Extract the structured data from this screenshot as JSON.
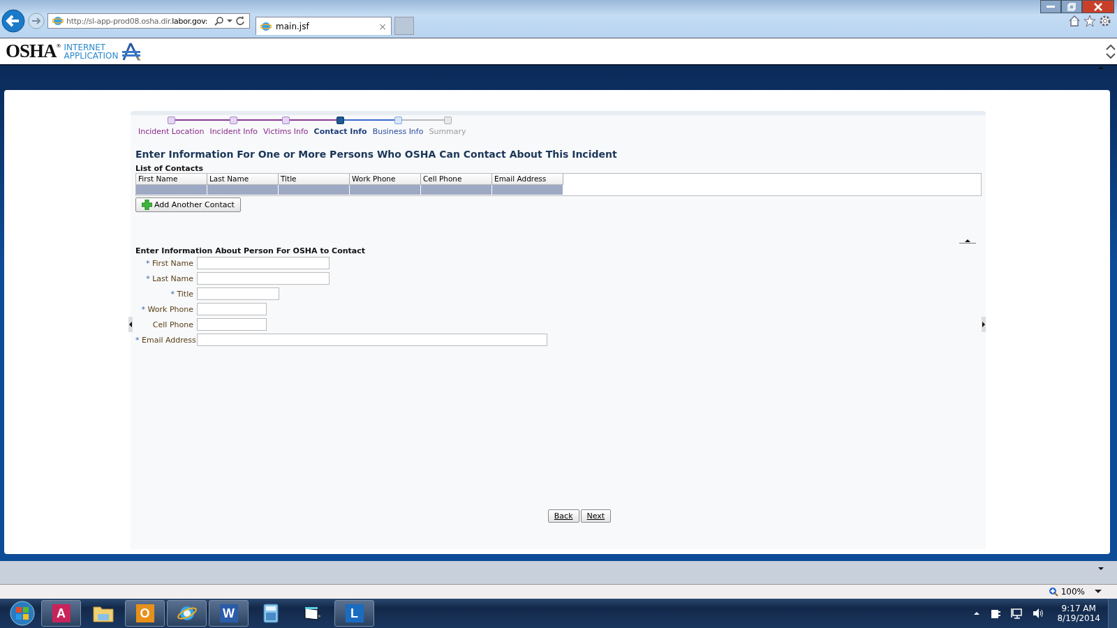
{
  "browser": {
    "url": "http://sl-app-prod08.osha.dir.**labor.gov:**",
    "tab": {
      "title": "main.jsf",
      "close": "×"
    }
  },
  "logo": {
    "mark": "OSHA",
    "registered": "®",
    "line_1": "INTERNET",
    "line_2": "APPLICATION"
  },
  "steps": [
    {
      "label": "Incident Location",
      "kind": "completed"
    },
    {
      "label": "Incident Info",
      "kind": "completed"
    },
    {
      "label": "Victims Info",
      "kind": "completed"
    },
    {
      "label": "Contact Info",
      "kind": "current"
    },
    {
      "label": "Business Info",
      "kind": "next"
    },
    {
      "label": "Summary",
      "kind": "pending"
    }
  ],
  "heading": "Enter Information For One or More Persons Who OSHA Can Contact About This Incident",
  "table": {
    "title": "List of Contacts",
    "columns": [
      "First Name",
      "Last Name",
      "Title",
      "Work Phone",
      "Cell Phone",
      "Email Address"
    ],
    "rows": [
      {
        "selected": true
      }
    ]
  },
  "add_button": "Add Another Contact",
  "form": {
    "title": "Enter Information About Person For OSHA to Contact",
    "fields": [
      {
        "mark": "*",
        "label": "First Name",
        "kind": "long"
      },
      {
        "mark": "*",
        "label": "Last Name",
        "kind": "long"
      },
      {
        "mark": "*",
        "label": "Title",
        "kind": "medium"
      },
      {
        "mark": "*",
        "label": "Work Phone",
        "kind": "short"
      },
      {
        "label": "Cell Phone",
        "kind": "short"
      },
      {
        "mark": "*",
        "label": "Email Address",
        "kind": "wide"
      }
    ]
  },
  "nav_buttons": [
    "Back",
    "Next"
  ],
  "status_bar": {
    "zoom": "100%"
  },
  "taskbar": {
    "apps": [
      {
        "kind": "tile",
        "letter": "A",
        "color": "#c8245a",
        "running": true
      },
      {
        "kind": "folder",
        "running": false
      },
      {
        "kind": "tile",
        "letter": "O",
        "color": "#e8901a",
        "running": true
      },
      {
        "kind": "browser",
        "running": true
      },
      {
        "kind": "tile",
        "letter": "W",
        "color": "#2a5caa",
        "running": true
      },
      {
        "kind": "calculator",
        "running": false
      },
      {
        "kind": "window",
        "running": false
      },
      {
        "kind": "tile",
        "letter": "L",
        "color": "#1a6cc0",
        "running": true
      }
    ],
    "time": "9:17 AM",
    "date": "8/19/2014"
  }
}
